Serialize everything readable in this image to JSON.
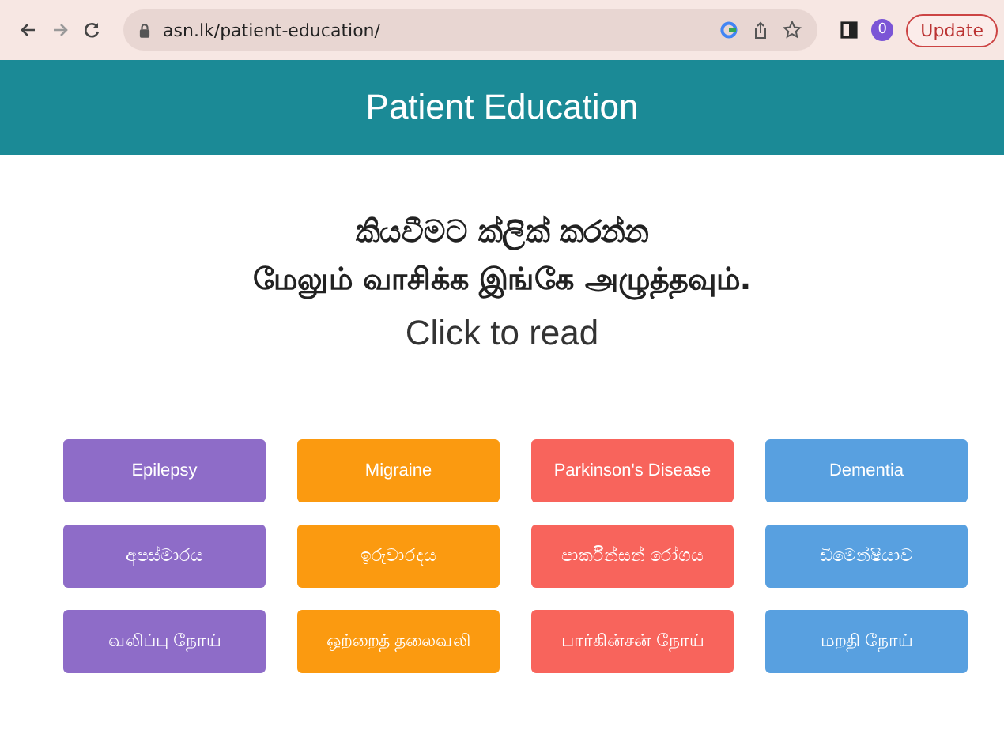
{
  "browser": {
    "url": "asn.lk/patient-education/",
    "profile": "0",
    "update_button": "Update"
  },
  "header": {
    "title": "Patient Education"
  },
  "intro": [
    "කියවීමට ක්ලික් කරන්න",
    "மேலும் வாசிக்க இங்கே அழுத்தவும்.",
    "Click to read"
  ],
  "button_rows": [
    [
      {
        "label": "Epilepsy",
        "color": "#8e6cc8"
      },
      {
        "label": "Migraine",
        "color": "#fb9a10"
      },
      {
        "label": "Parkinson's Disease",
        "color": "#f8645c"
      },
      {
        "label": "Dementia",
        "color": "#58a0e0"
      }
    ],
    [
      {
        "label": "අපස්මාරය",
        "color": "#8e6cc8"
      },
      {
        "label": "ඉරුවාරදය",
        "color": "#fb9a10"
      },
      {
        "label": "පාර්කින්සන් රෝගය",
        "color": "#f8645c"
      },
      {
        "label": "ඩිමෙන්ෂියාව",
        "color": "#58a0e0"
      }
    ],
    [
      {
        "label": "வலிப்பு நோய்",
        "color": "#8e6cc8"
      },
      {
        "label": "ஒற்றைத் தலைவலி",
        "color": "#fb9a10"
      },
      {
        "label": "பார்கின்சன் நோய்",
        "color": "#f8645c"
      },
      {
        "label": "மறதி நோய்",
        "color": "#58a0e0"
      }
    ]
  ]
}
